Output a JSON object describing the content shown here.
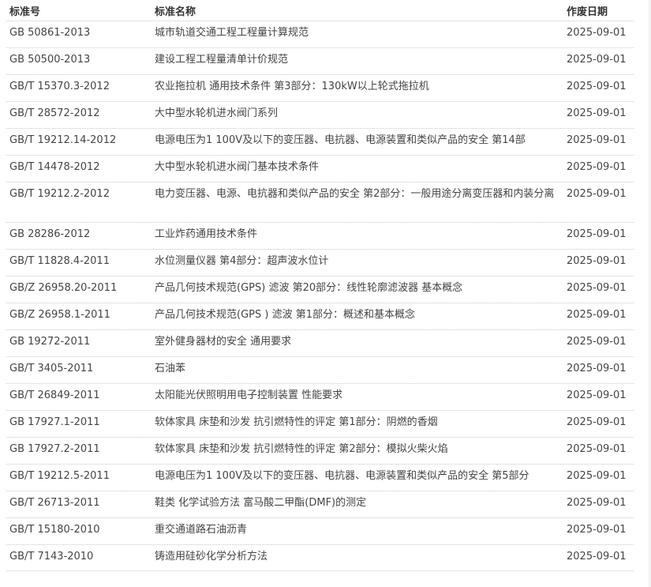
{
  "header": {
    "code": "标准号",
    "name": "标准名称",
    "date": "作废日期"
  },
  "rows": [
    {
      "code": "GB 50861-2013",
      "name": "城市轨道交通工程工程量计算规范",
      "date": "2025-09-01"
    },
    {
      "code": "GB 50500-2013",
      "name": "建设工程工程量清单计价规范",
      "date": "2025-09-01"
    },
    {
      "code": "GB/T 15370.3-2012",
      "name": "农业拖拉机 通用技术条件 第3部分：130kW以上轮式拖拉机",
      "date": "2025-09-01"
    },
    {
      "code": "GB/T 28572-2012",
      "name": "大中型水轮机进水阀门系列",
      "date": "2025-09-01"
    },
    {
      "code": "GB/T 19212.14-2012",
      "name": "电源电压为1 100V及以下的变压器、电抗器、电源装置和类似产品的安全 第14部",
      "date": "2025-09-01"
    },
    {
      "code": "GB/T 14478-2012",
      "name": "大中型水轮机进水阀门基本技术条件",
      "date": "2025-09-01"
    },
    {
      "code": "GB/T 19212.2-2012",
      "name": "电力变压器、电源、电抗器和类似产品的安全 第2部分：一般用途分离变压器和内装分离",
      "date": "2025-09-01"
    },
    {
      "code": "GB 28286-2012",
      "name": "工业炸药通用技术条件",
      "date": "2025-09-01"
    },
    {
      "code": "GB/T 11828.4-2011",
      "name": "水位测量仪器 第4部分：超声波水位计",
      "date": "2025-09-01"
    },
    {
      "code": "GB/Z 26958.20-2011",
      "name": "产品几何技术规范(GPS) 滤波 第20部分：线性轮廓滤波器 基本概念",
      "date": "2025-09-01"
    },
    {
      "code": "GB/Z 26958.1-2011",
      "name": "产品几何技术规范(GPS ) 滤波 第1部分：概述和基本概念",
      "date": "2025-09-01"
    },
    {
      "code": "GB 19272-2011",
      "name": "室外健身器材的安全 通用要求",
      "date": "2025-09-01"
    },
    {
      "code": "GB/T 3405-2011",
      "name": "石油苯",
      "date": "2025-09-01"
    },
    {
      "code": "GB/T 26849-2011",
      "name": "太阳能光伏照明用电子控制装置 性能要求",
      "date": "2025-09-01"
    },
    {
      "code": "GB 17927.1-2011",
      "name": "软体家具 床垫和沙发 抗引燃特性的评定 第1部分：阴燃的香烟",
      "date": "2025-09-01"
    },
    {
      "code": "GB 17927.2-2011",
      "name": "软体家具 床垫和沙发 抗引燃特性的评定 第2部分：模拟火柴火焰",
      "date": "2025-09-01"
    },
    {
      "code": "GB/T 19212.5-2011",
      "name": "电源电压为1 100V及以下的变压器、电抗器、电源装置和类似产品的安全 第5部分",
      "date": "2025-09-01"
    },
    {
      "code": "GB/T 26713-2011",
      "name": "鞋类 化学试验方法 富马酸二甲酯(DMF)的测定",
      "date": "2025-09-01"
    },
    {
      "code": "GB/T 15180-2010",
      "name": "重交通道路石油沥青",
      "date": "2025-09-01"
    },
    {
      "code": "GB/T 7143-2010",
      "name": "铸造用硅砂化学分析方法",
      "date": "2025-09-01"
    }
  ]
}
